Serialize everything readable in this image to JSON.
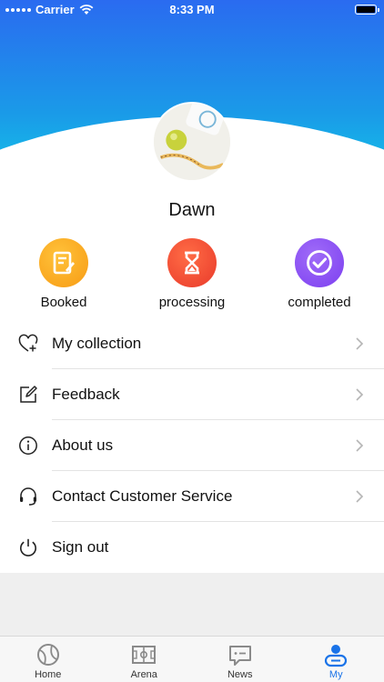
{
  "status_bar": {
    "carrier": "Carrier",
    "time": "8:33 PM"
  },
  "profile": {
    "name": "Dawn"
  },
  "order_status": [
    {
      "label": "Booked",
      "icon": "booked-icon",
      "color": "#f7a41c"
    },
    {
      "label": "processing",
      "icon": "hourglass-icon",
      "color": "#f24b35"
    },
    {
      "label": "completed",
      "icon": "check-circle-icon",
      "color": "#8a4ef2"
    }
  ],
  "menu": [
    {
      "label": "My collection",
      "icon": "heart-plus-icon",
      "has_chevron": true
    },
    {
      "label": "Feedback",
      "icon": "edit-icon",
      "has_chevron": true
    },
    {
      "label": "About us",
      "icon": "info-icon",
      "has_chevron": true
    },
    {
      "label": "Contact Customer Service",
      "icon": "headset-icon",
      "has_chevron": true
    },
    {
      "label": "Sign out",
      "icon": "power-icon",
      "has_chevron": false
    }
  ],
  "tabs": [
    {
      "label": "Home",
      "icon": "ball-icon",
      "active": false
    },
    {
      "label": "Arena",
      "icon": "field-icon",
      "active": false
    },
    {
      "label": "News",
      "icon": "chat-icon",
      "active": false
    },
    {
      "label": "My",
      "icon": "person-icon",
      "active": true
    }
  ],
  "colors": {
    "accent": "#1a73e8",
    "gradient_top": "#2a6bf0",
    "gradient_bottom": "#10d6e8"
  }
}
